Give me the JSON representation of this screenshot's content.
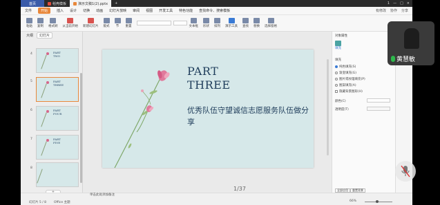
{
  "titlebar": {
    "home": "首页",
    "tabs": [
      "稻壳模板",
      "演示文稿1(2).pptx"
    ],
    "right": [
      "1",
      "—",
      "□",
      "×"
    ]
  },
  "menu": {
    "items": [
      "文件",
      "开始",
      "插入",
      "设计",
      "切换",
      "动画",
      "幻灯片放映",
      "审阅",
      "视图",
      "开发工具",
      "特色功能"
    ],
    "search": "查找命令、搜索模板",
    "right": [
      "有修改",
      "协作",
      "分享"
    ]
  },
  "toolbar": {
    "tools": [
      "粘贴",
      "复制",
      "格式刷",
      "从当前开始",
      "新建幻灯片",
      "版式",
      "节",
      "重置",
      "文本框",
      "形状",
      "排列",
      "演示工具",
      "查找",
      "替换",
      "选择窗格"
    ]
  },
  "leftpane": {
    "tabs": [
      "大纲",
      "幻灯片"
    ],
    "slides": [
      {
        "num": "4",
        "part": "PART\nTWO",
        "sub": ""
      },
      {
        "num": "5",
        "part": "PART\nTHREE",
        "sub": ""
      },
      {
        "num": "6",
        "part": "PART\nFOUR",
        "sub": ""
      },
      {
        "num": "7",
        "part": "PART\nFIVE",
        "sub": ""
      },
      {
        "num": "8",
        "part": "",
        "sub": ""
      }
    ],
    "add": "+"
  },
  "slide": {
    "line1": "PART",
    "line2": "THREE",
    "subtitle": "优秀队伍守望诚信志愿服务队伍做分享",
    "page_indicator": "1/37"
  },
  "props": {
    "title": "对象属性",
    "tab": "填充",
    "section": "填充",
    "options": [
      "纯色填充(S)",
      "渐变填充(G)",
      "图片或纹理填充(P)",
      "图案填充(A)",
      "隐藏背景图形(H)"
    ],
    "color_label": "颜色(C)",
    "transparency_label": "透明度(T)",
    "buttons": [
      "全部应用",
      "重置背景"
    ]
  },
  "status": {
    "slide": "幻灯片 5 / 8",
    "theme": "Office 主题",
    "notes": "单击此处添加备注",
    "zoom": "66%"
  },
  "video": {
    "name": "黄慧敏"
  }
}
